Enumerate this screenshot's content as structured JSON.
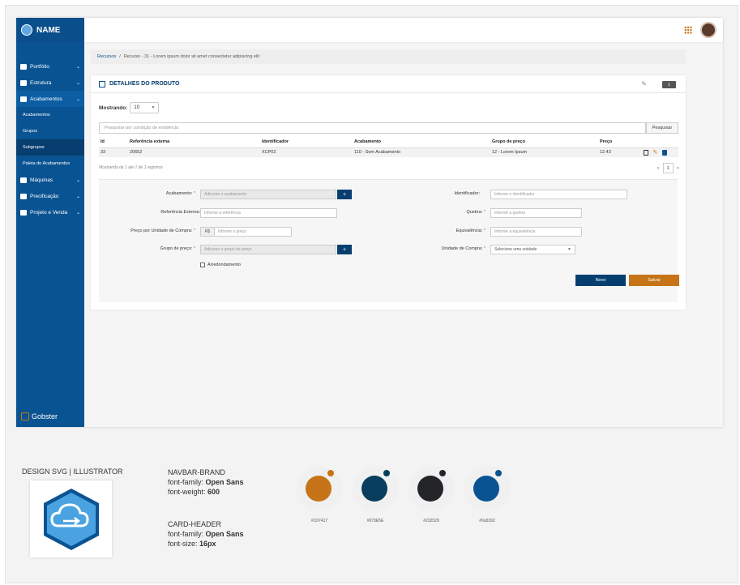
{
  "brand": {
    "name": "NAME",
    "footer_logo": "Gobster"
  },
  "sidebar": {
    "items": [
      {
        "label": "Portfólio",
        "icon": "portfolio-icon"
      },
      {
        "label": "Estrutura",
        "icon": "structure-icon"
      },
      {
        "label": "Acabamentos",
        "icon": "finishing-icon"
      },
      {
        "label": "Máquinas",
        "icon": "gear-icon"
      },
      {
        "label": "Precificação",
        "icon": "pricing-icon"
      },
      {
        "label": "Projeto e Venda",
        "icon": "project-icon"
      }
    ],
    "subitems": [
      "Acabamentos",
      "Grupos",
      "Subgrupos",
      "Paleta de Acabamentos"
    ]
  },
  "breadcrumb": {
    "link": "Recursos",
    "separator": "/",
    "current": "Recurso - 31 - Lorem ipsum dolor sit amet consectetur adipiscing elit"
  },
  "card": {
    "title": "DETALHES DO PRODUTO",
    "badge": "1",
    "showing_label": "Mostrando:",
    "showing_value": "10",
    "search_placeholder": "Pesquisar por condição de existência",
    "search_button": "Pesquisar",
    "columns": [
      "Id",
      "Referência externa",
      "Identificador",
      "Acabamento",
      "Grupo de preço",
      "Preço"
    ],
    "row": {
      "id": "33",
      "ref": "20652",
      "ident": "XCP02",
      "acab": "110 - Sem Acabamento",
      "grupo": "12 - Lorem Ipsum",
      "preco": "12.43"
    },
    "footer_info": "Mostrando de 1 até 1 de 1 registros",
    "pager": {
      "prev": "«",
      "page": "1",
      "next": "»"
    }
  },
  "form": {
    "acabamento_label": "Acabamento:",
    "acabamento_placeholder": "Adicione o acabamento",
    "ref_label": "Referência Externa:",
    "ref_placeholder": "Informe a referência",
    "preco_label": "Preço por Unidade de Compra:",
    "preco_prefix": "R$",
    "preco_placeholder": "Informe o preço",
    "grupo_label": "Grupo de preço:",
    "grupo_placeholder": "Adicione o grupo de preço",
    "arredondamento_label": "Arredondamento",
    "ident_label": "Identificador:",
    "ident_placeholder": "Informe o identificador",
    "quebra_label": "Quebra:",
    "quebra_placeholder": "Informe a quebra",
    "equiv_label": "Equivalência:",
    "equiv_placeholder": "Informe a equivalência",
    "unidade_label": "Unidade de Compra:",
    "unidade_placeholder": "Selecione uma unidade",
    "required_mark": "*",
    "plus": "+",
    "novo": "Novo",
    "salvar": "Salvar"
  },
  "design": {
    "svg_label": "DESIGN SVG | ILLUSTRATOR",
    "navbar_title": "NAVBAR-BRAND",
    "navbar_family_label": "font-family:",
    "navbar_family": "Open Sans",
    "navbar_weight_label": "font-weight:",
    "navbar_weight": "600",
    "header_title": "CARD-HEADER",
    "header_family_label": "font-family:",
    "header_family": "Open Sans",
    "header_size_label": "font-size:",
    "header_size": "16px",
    "swatches": [
      {
        "hex": "#C67417",
        "color": "#c67417"
      },
      {
        "hex": "#073E5E",
        "color": "#073e5e"
      },
      {
        "hex": "#232529",
        "color": "#232529"
      },
      {
        "hex": "#0a5392",
        "color": "#0a5392"
      }
    ]
  }
}
